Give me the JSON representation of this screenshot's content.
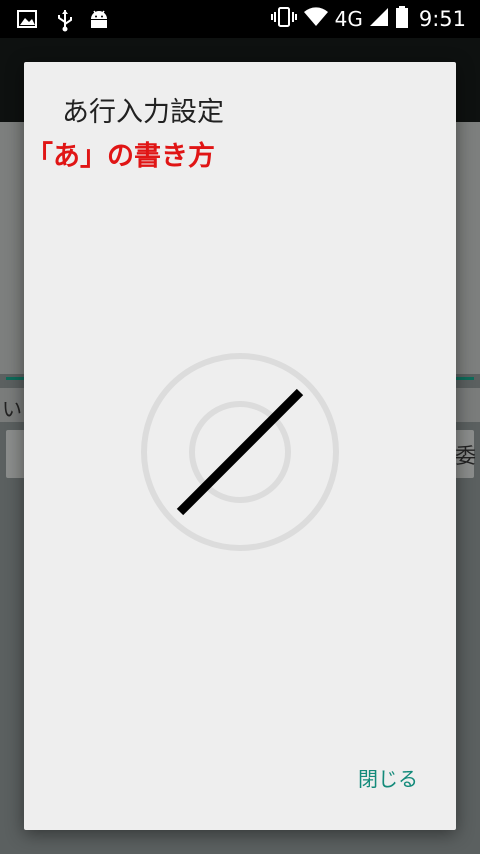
{
  "status_bar": {
    "icons": [
      "image-icon",
      "usb-icon",
      "android-icon",
      "vibrate-icon",
      "wifi-icon",
      "battery-icon"
    ],
    "network": "4G",
    "time": "9:51"
  },
  "background_app": {
    "row_text": "い",
    "box_text": "委"
  },
  "dialog": {
    "title": "あ行入力設定",
    "subtitle": "「あ」の書き方",
    "close_label": "閉じる"
  },
  "colors": {
    "subtitle": "#e01515",
    "button": "#138a7a",
    "accent": "#0f6b5a"
  }
}
